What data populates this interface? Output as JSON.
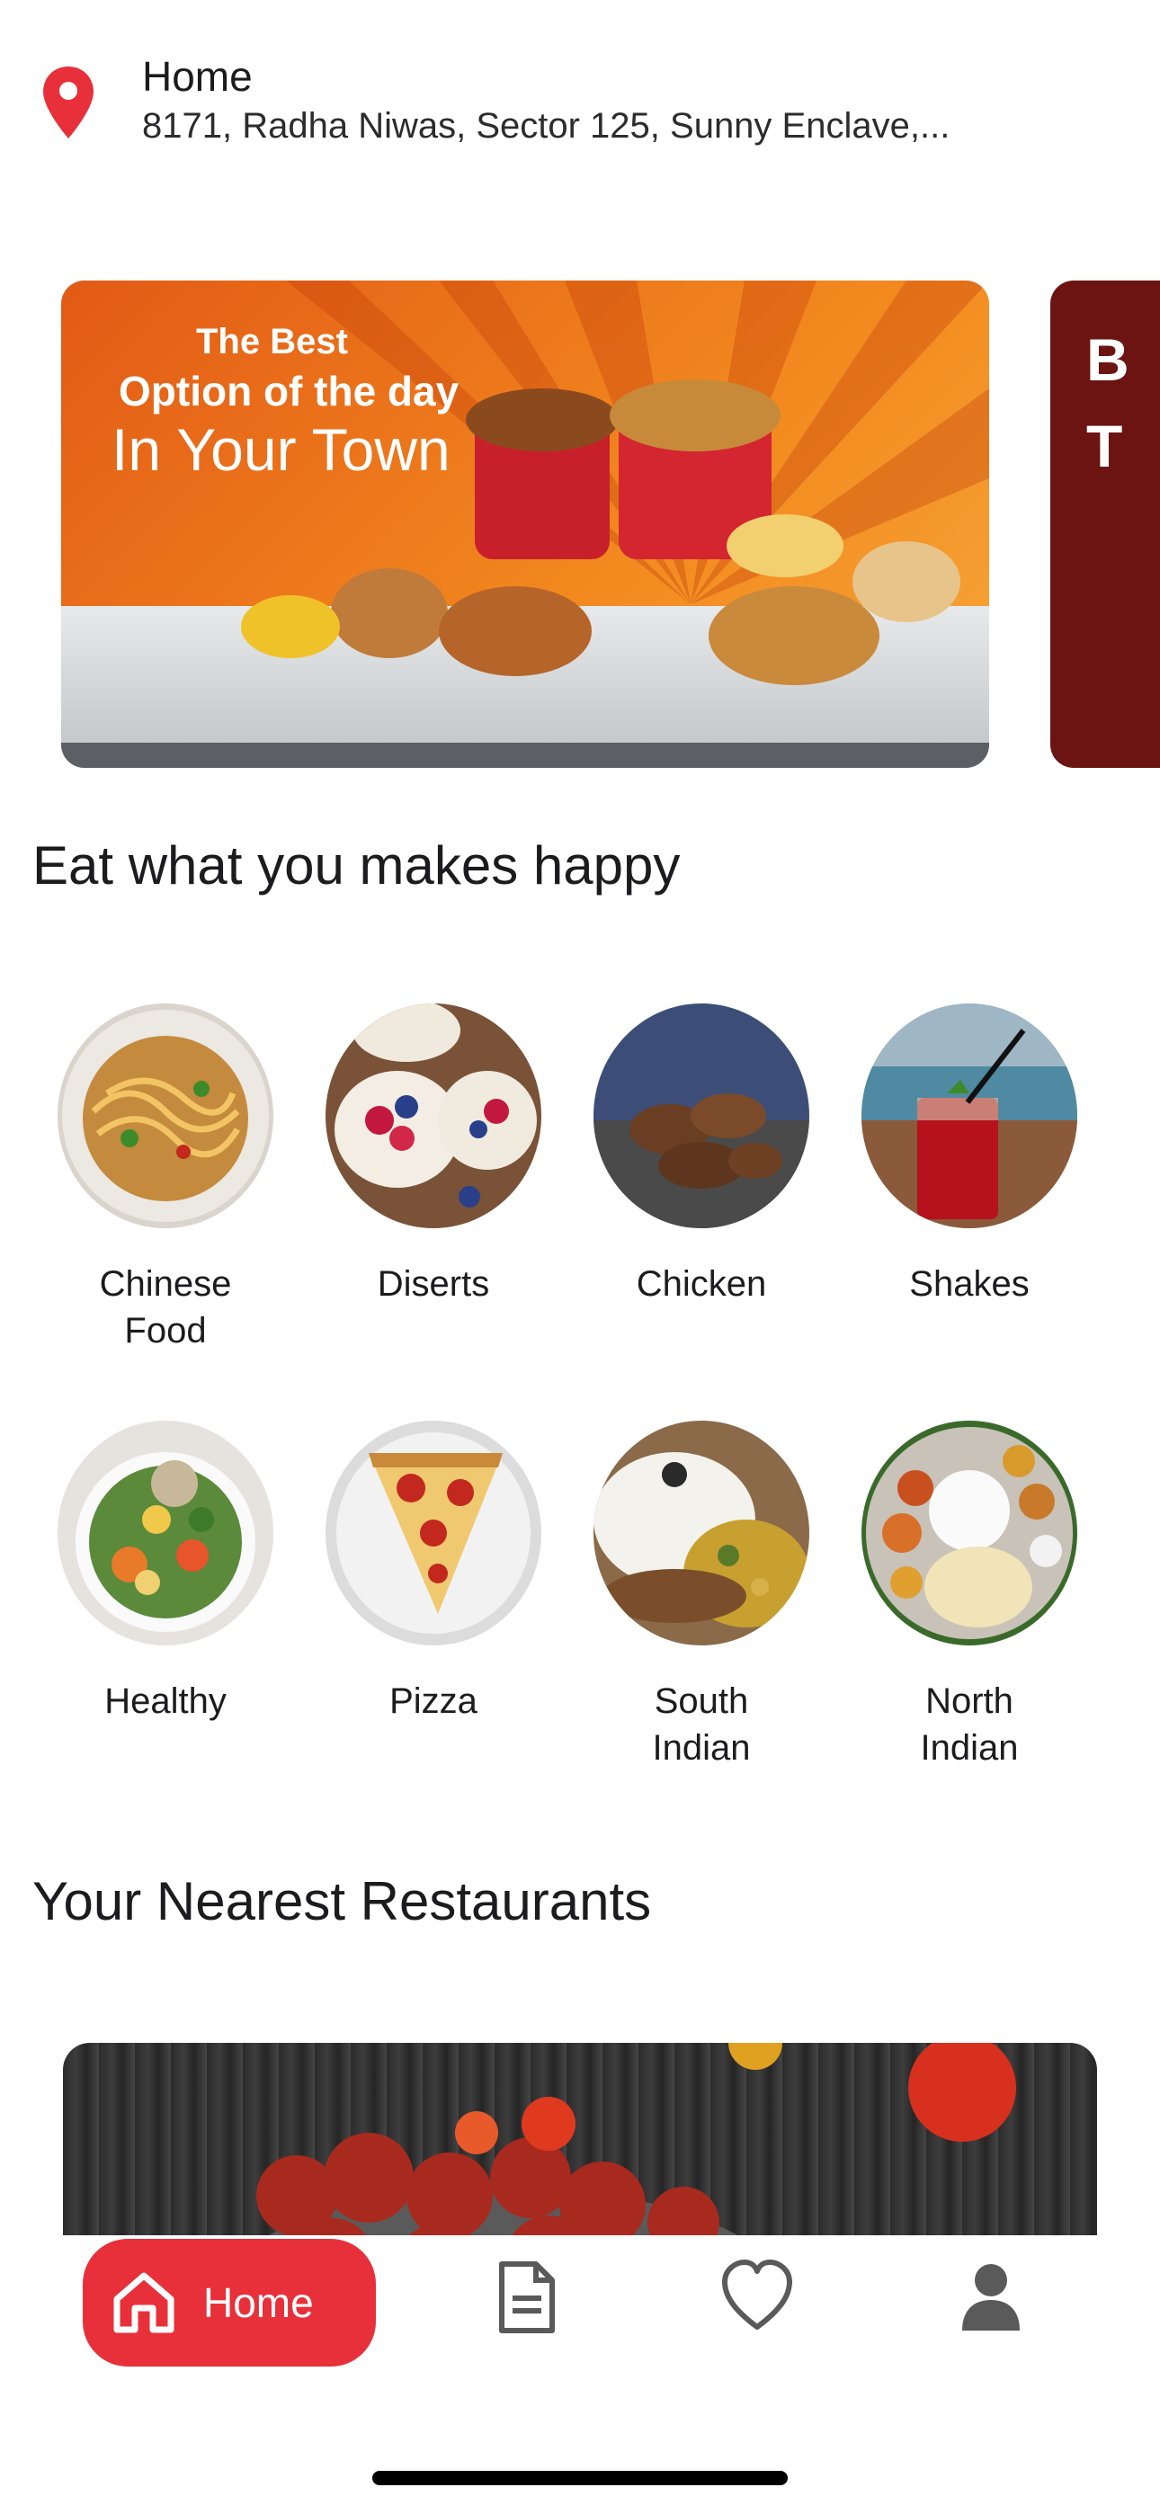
{
  "header": {
    "location_label": "Home",
    "address": "8171, Radha Niwas, Sector 125, Sunny Enclave,..."
  },
  "banners": [
    {
      "line1": "The Best",
      "line2": "Option of the day",
      "line3": "In Your Town"
    },
    {
      "text": "B\nT"
    }
  ],
  "sections": {
    "categories_title": "Eat what you makes happy",
    "restaurants_title": "Your Nearest Restaurants"
  },
  "categories": [
    {
      "label": "Chinese\nFood",
      "icon": "noodles-bowl"
    },
    {
      "label": "Diserts",
      "icon": "dessert-tarts"
    },
    {
      "label": "Chicken",
      "icon": "grilled-chicken"
    },
    {
      "label": "Shakes",
      "icon": "drink-glass"
    },
    {
      "label": "Healthy",
      "icon": "salad-bowl"
    },
    {
      "label": "Pizza",
      "icon": "pizza-slice"
    },
    {
      "label": "South\nIndian",
      "icon": "rice-curry"
    },
    {
      "label": "North\nIndian",
      "icon": "thali-plate"
    }
  ],
  "bottom_nav": {
    "home_label": "Home",
    "items": [
      "home-icon",
      "orders-icon",
      "favorites-icon",
      "profile-icon"
    ]
  },
  "colors": {
    "accent": "#e8303a",
    "banner_orange": "#f38a1f",
    "banner2_bg": "#6b1412"
  }
}
